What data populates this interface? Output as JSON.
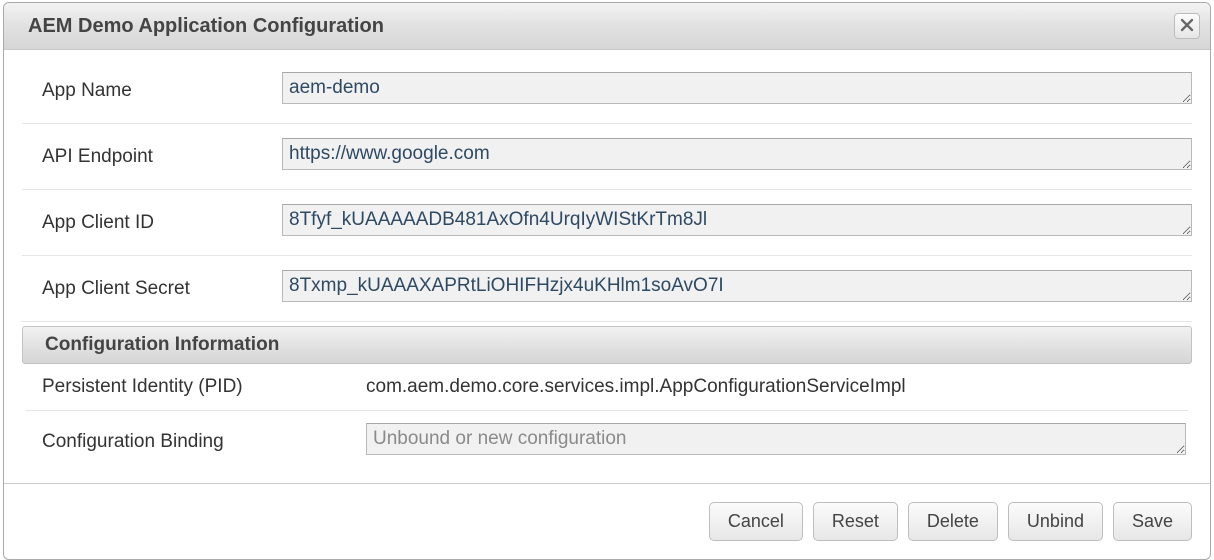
{
  "dialog": {
    "title": "AEM Demo Application Configuration"
  },
  "fields": {
    "appName": {
      "label": "App Name",
      "value": "aem-demo"
    },
    "endpoint": {
      "label": "API Endpoint",
      "value": "https://www.google.com"
    },
    "clientId": {
      "label": "App Client ID",
      "value": "8Tfyf_kUAAAAADB481AxOfn4UrqIyWIStKrTm8Jl"
    },
    "clientSecret": {
      "label": "App Client Secret",
      "value": "8Txmp_kUAAAXAPRtLiOHIFHzjx4uKHlm1soAvO7I"
    }
  },
  "infoSection": {
    "header": "Configuration Information",
    "pid": {
      "label": "Persistent Identity (PID)",
      "value": "com.aem.demo.core.services.impl.AppConfigurationServiceImpl"
    },
    "binding": {
      "label": "Configuration Binding",
      "value": "Unbound or new configuration"
    }
  },
  "buttons": {
    "cancel": "Cancel",
    "reset": "Reset",
    "delete": "Delete",
    "unbind": "Unbind",
    "save": "Save"
  }
}
